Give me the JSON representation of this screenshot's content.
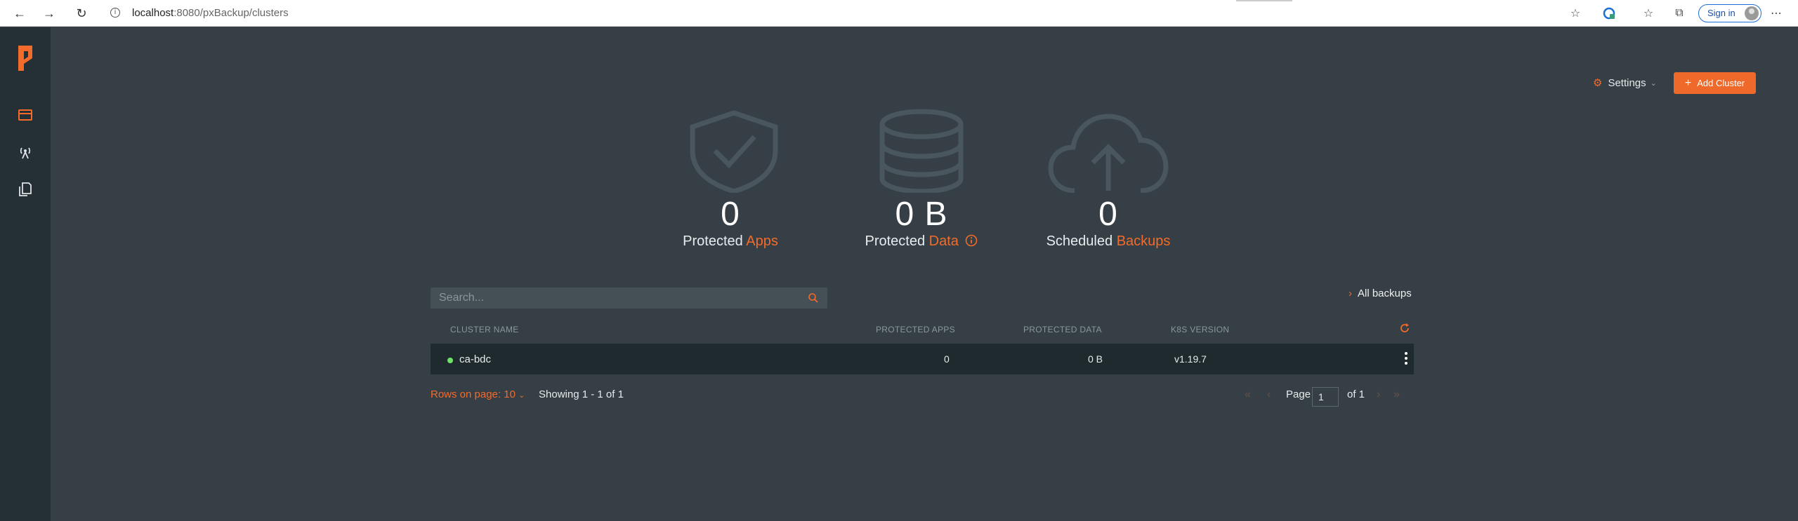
{
  "browser": {
    "url_host": "localhost",
    "url_path": ":8080/pxBackup/clusters",
    "signin_label": "Sign in"
  },
  "header": {
    "settings_label": "Settings",
    "add_cluster_label": "Add Cluster"
  },
  "stats": [
    {
      "value": "0",
      "label": "Protected",
      "accent": "Apps",
      "icon": "shield-check-icon"
    },
    {
      "value": "0 B",
      "label": "Protected",
      "accent": "Data",
      "icon": "database-icon"
    },
    {
      "value": "0",
      "label": "Scheduled",
      "accent": "Backups",
      "icon": "cloud-upload-icon"
    }
  ],
  "search": {
    "placeholder": "Search..."
  },
  "all_backups_label": "All backups",
  "table": {
    "columns": [
      "CLUSTER NAME",
      "PROTECTED APPS",
      "PROTECTED DATA",
      "K8S VERSION"
    ],
    "rows": [
      {
        "name": "ca-bdc",
        "protected_apps": "0",
        "protected_data": "0 B",
        "k8s_version": "v1.19.7",
        "status": "online"
      }
    ]
  },
  "footer": {
    "rows_on_page": "Rows on page: 10",
    "showing": "Showing 1 - 1 of 1",
    "page_label": "Page",
    "page_value": "1",
    "of_label": "of 1"
  },
  "colors": {
    "accent": "#f26b2b",
    "background": "#353f45",
    "sidebar": "#253036",
    "row": "#1f2a2f",
    "status_online": "#6fe36b"
  }
}
